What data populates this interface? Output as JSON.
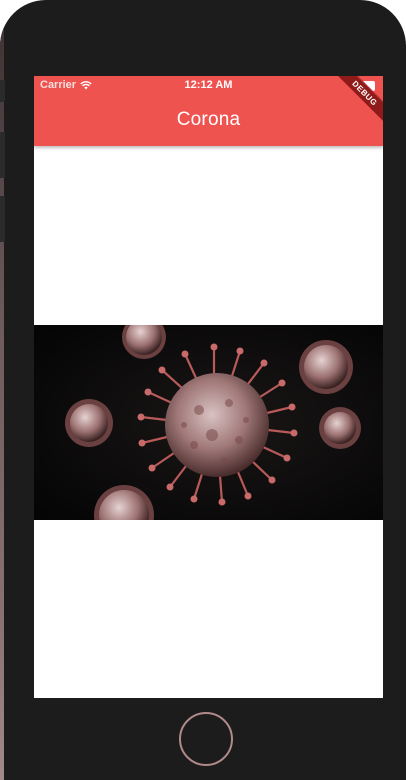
{
  "status_bar": {
    "carrier": "Carrier",
    "time": "12:12 AM"
  },
  "app_bar": {
    "title": "Corona",
    "color": "#ef5350"
  },
  "debug_banner": {
    "label": "DEBUG"
  },
  "image": {
    "subject": "coronavirus-particles"
  },
  "icons": [
    "wifi-icon",
    "battery-icon",
    "home-button"
  ]
}
